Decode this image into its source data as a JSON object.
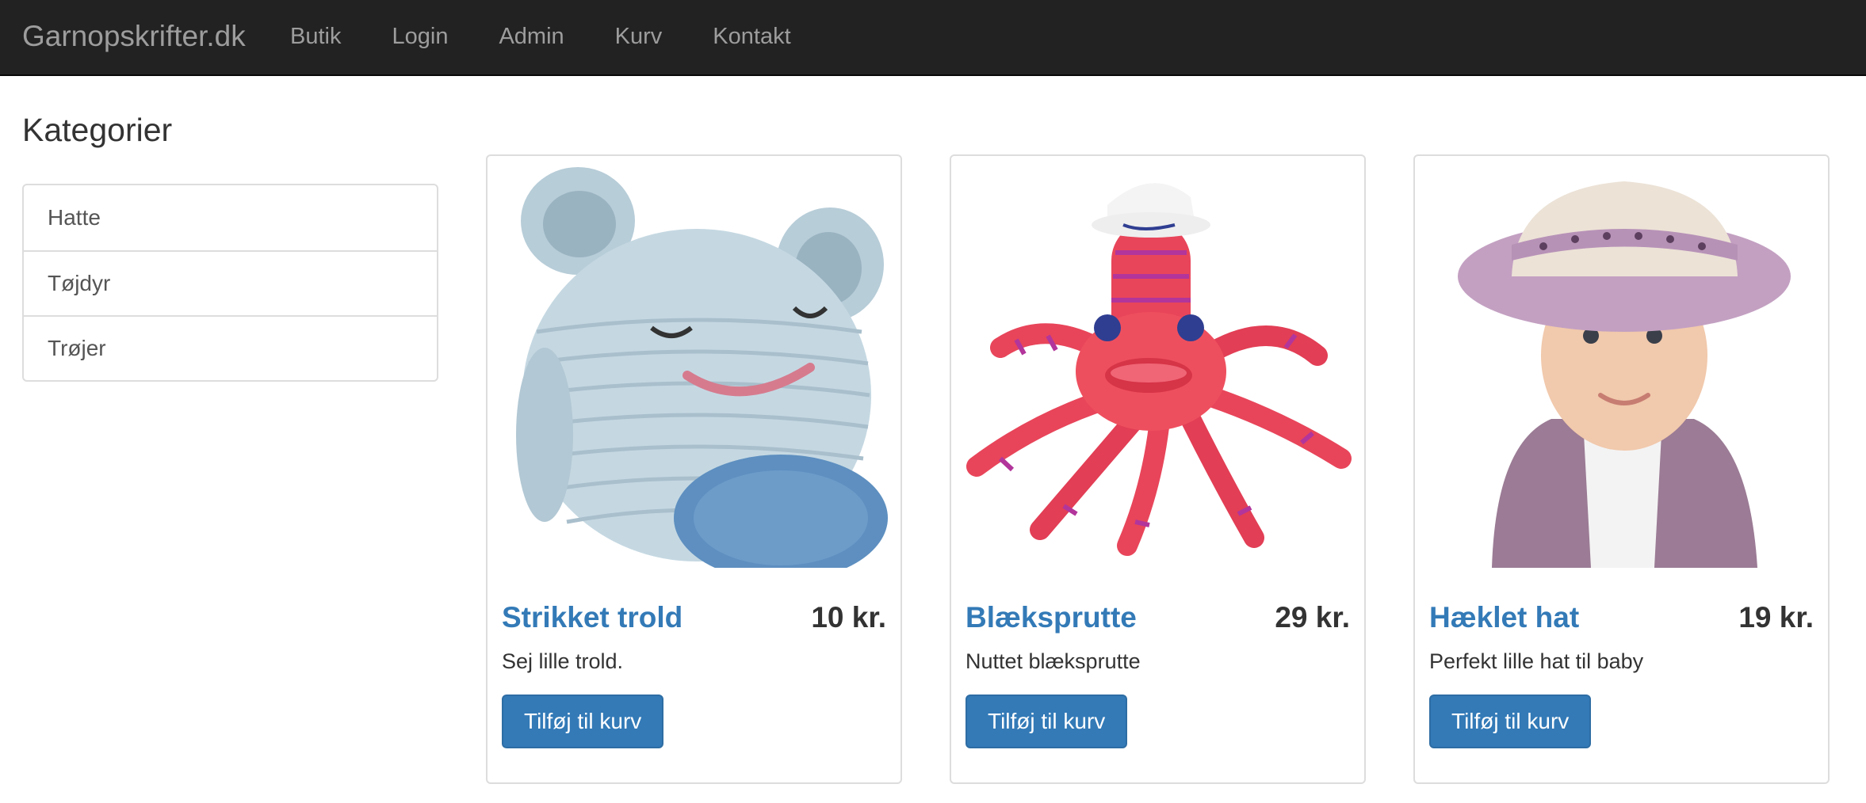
{
  "navbar": {
    "brand": "Garnopskrifter.dk",
    "links": [
      "Butik",
      "Login",
      "Admin",
      "Kurv",
      "Kontakt"
    ]
  },
  "sidebar": {
    "title": "Kategorier",
    "items": [
      "Hatte",
      "Tøjdyr",
      "Trøjer"
    ]
  },
  "products": [
    {
      "title": "Strikket trold",
      "price": "10 kr.",
      "description": "Sej lille trold.",
      "button": "Tilføj til kurv"
    },
    {
      "title": "Blæksprutte",
      "price": "29 kr.",
      "description": "Nuttet blæksprutte",
      "button": "Tilføj til kurv"
    },
    {
      "title": "Hæklet hat",
      "price": "19 kr.",
      "description": "Perfekt lille hat til baby",
      "button": "Tilføj til kurv"
    }
  ],
  "colors": {
    "navbar_bg": "#222222",
    "nav_text": "#9d9d9d",
    "link": "#337ab7",
    "button": "#337ab7"
  }
}
